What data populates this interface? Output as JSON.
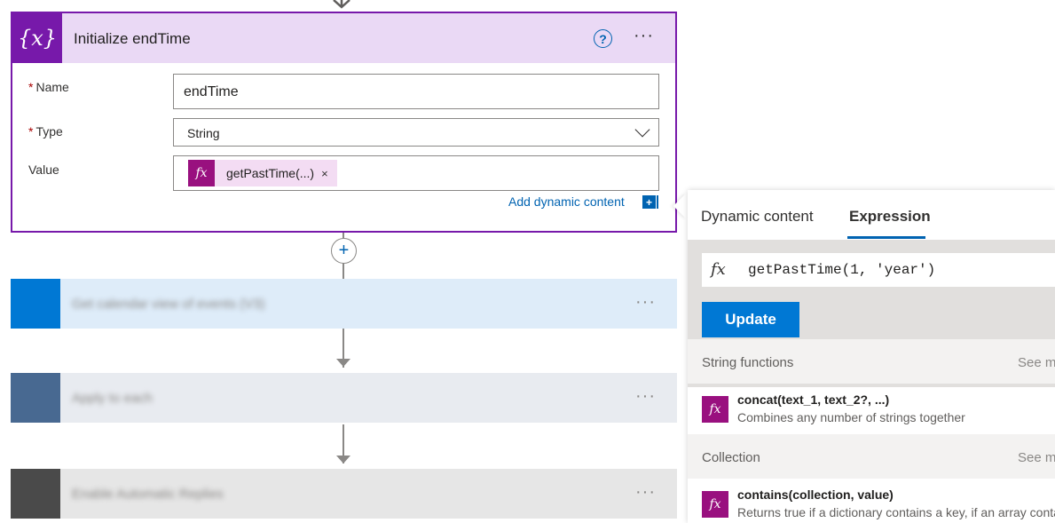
{
  "card": {
    "title": "Initialize endTime",
    "icon": "variable-icon",
    "name_label": "Name",
    "name_value": "endTime",
    "type_label": "Type",
    "type_value": "String",
    "value_label": "Value",
    "token_label": "getPastTime(...)",
    "token_remove": "×",
    "add_dynamic": "Add dynamic content",
    "required_marker": "*",
    "accent": "#7719aa"
  },
  "steps": [
    {
      "title": "Get calendar view of events (V3)",
      "icon_color": "#0078d4",
      "bg": "#deecf9"
    },
    {
      "title": "Apply to each",
      "icon_color": "#486991",
      "bg": "#e8ebf0"
    },
    {
      "title": "Enable Automatic Replies",
      "icon_color": "#4a4a4a",
      "bg": "#e6e6e6"
    }
  ],
  "panel": {
    "tab_dynamic": "Dynamic content",
    "tab_expression": "Expression",
    "expression": "getPastTime(1, 'year')",
    "update_label": "Update",
    "sections": [
      {
        "title": "String functions",
        "see_more": "See more",
        "func_name": "concat(text_1, text_2?, ...)",
        "func_desc": "Combines any number of strings together"
      },
      {
        "title": "Collection",
        "see_more": "See more",
        "func_name": "contains(collection, value)",
        "func_desc": "Returns true if a dictionary contains a key, if an array contains a value"
      }
    ]
  }
}
